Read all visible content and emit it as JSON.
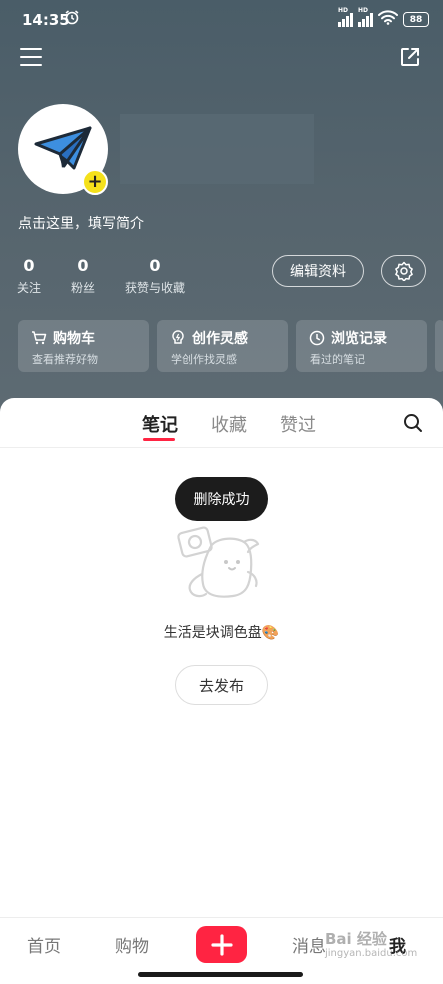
{
  "status_bar": {
    "time": "14:35",
    "battery": "88",
    "signal_labels": [
      "HD",
      "HD"
    ]
  },
  "profile": {
    "bio": "点击这里，填写简介",
    "stats": [
      {
        "value": "0",
        "label": "关注"
      },
      {
        "value": "0",
        "label": "粉丝"
      },
      {
        "value": "0",
        "label": "获赞与收藏"
      }
    ],
    "edit_label": "编辑资料"
  },
  "cards": [
    {
      "title": "购物车",
      "subtitle": "查看推荐好物",
      "icon": "cart-icon"
    },
    {
      "title": "创作灵感",
      "subtitle": "学创作找灵感",
      "icon": "lightbulb-icon"
    },
    {
      "title": "浏览记录",
      "subtitle": "看过的笔记",
      "icon": "clock-icon"
    }
  ],
  "tabs": [
    {
      "label": "笔记",
      "active": true
    },
    {
      "label": "收藏",
      "active": false
    },
    {
      "label": "赞过",
      "active": false
    }
  ],
  "toast": "删除成功",
  "empty": {
    "text": "生活是块调色盘🎨",
    "button": "去发布"
  },
  "bottom_nav": {
    "items": [
      "首页",
      "购物",
      "消息",
      "我"
    ],
    "active": "我"
  },
  "watermark": {
    "brand": "Bai 经验",
    "url": "jingyan.baidu.com"
  },
  "colors": {
    "accent": "#ff2442",
    "avatar_badge": "#f5e11b",
    "header_bg": "#55646d"
  }
}
